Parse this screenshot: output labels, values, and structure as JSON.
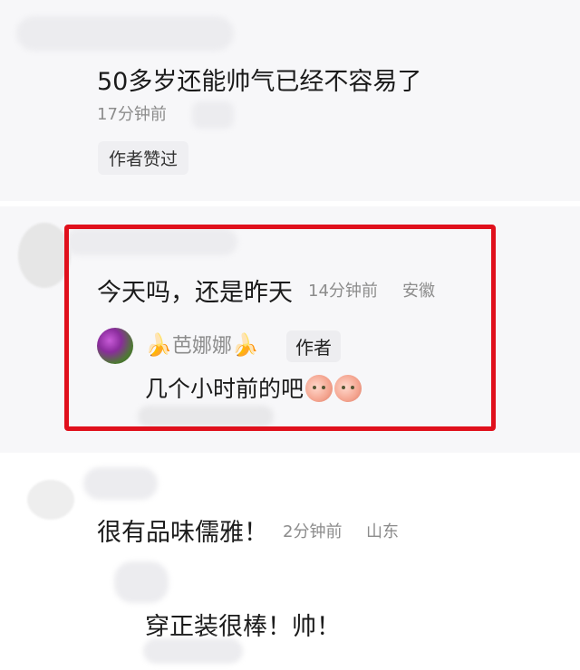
{
  "comments": [
    {
      "text": "50多岁还能帅气已经不容易了",
      "time": "17分钟前",
      "liked_by_author": "作者赞过"
    },
    {
      "text": "今天吗，还是昨天",
      "time": "14分钟前",
      "location": "安徽",
      "reply": {
        "user": "芭娜娜",
        "badge": "作者",
        "text": "几个小时前的吧",
        "emoji": "peach-face-emoji"
      }
    },
    {
      "text": "很有品味儒雅！",
      "time": "2分钟前",
      "location": "山东"
    },
    {
      "text": "穿正装很棒！帅！"
    }
  ],
  "colors": {
    "highlight_border": "#e0101c",
    "meta_text": "#8c8c8c",
    "card_bg": "#f7f7f9"
  }
}
